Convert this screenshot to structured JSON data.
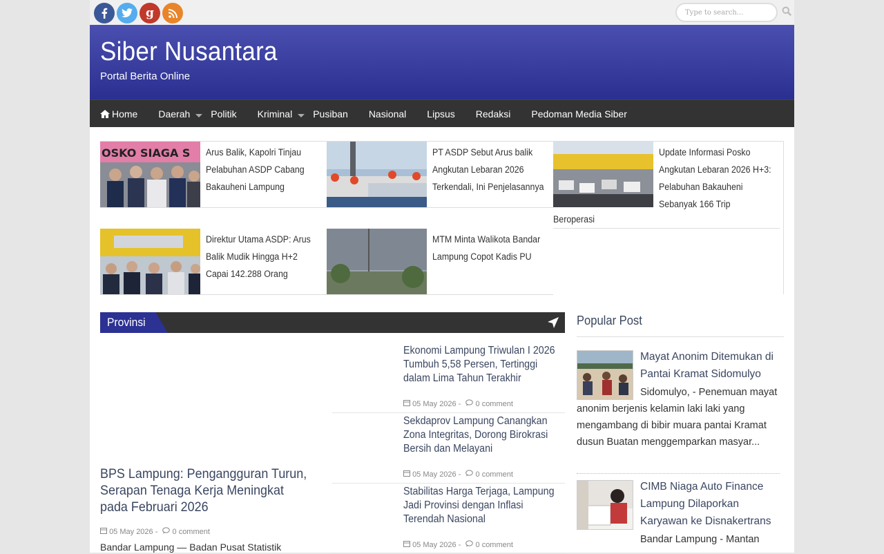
{
  "search": {
    "placeholder": "Type to search..."
  },
  "social": [
    {
      "name": "facebook",
      "color": "#3b5998",
      "glyph": "f"
    },
    {
      "name": "twitter",
      "color": "#55acee",
      "glyph": "t"
    },
    {
      "name": "google-plus",
      "color": "#c0392b",
      "glyph": "g"
    },
    {
      "name": "rss",
      "color": "#e8852b",
      "glyph": "rss"
    }
  ],
  "header": {
    "title": "Siber Nusantara",
    "description": "Portal Berita Online"
  },
  "nav": {
    "items": [
      {
        "label": "Home",
        "icon": "home-icon"
      },
      {
        "label": "Daerah",
        "has_sub": true
      },
      {
        "label": "Politik"
      },
      {
        "label": "Kriminal",
        "has_sub": true
      },
      {
        "label": "Pusiban"
      },
      {
        "label": "Nasional"
      },
      {
        "label": "Lipsus"
      },
      {
        "label": "Redaksi"
      },
      {
        "label": "Pedoman Media Siber"
      }
    ]
  },
  "featured": [
    "Arus Balik, Kapolri Tinjau Pelabuhan ASDP Cabang Bakauheni Lampung",
    "PT ASDP Sebut Arus balik Angkutan Lebaran 2026 Terkendali, Ini Penjelasannya",
    "Update Informasi Posko Angkutan Lebaran 2026 H+3: Pelabuhan Bakauheni Sebanyak 166 Trip",
    "Direktur Utama ASDP: Arus Balik Mudik Hingga H+2 Capai 142.288 Orang",
    "MTM Minta Walikota Bandar Lampung Copot Kadis PU"
  ],
  "featured_overflow": "Beroperasi",
  "section": {
    "label": "Provinsi",
    "icon": "location-arrow-icon"
  },
  "lead": {
    "title": "BPS Lampung: Pengangguran Turun, Serapan Tenaga Kerja Meningkat pada Februari 2026",
    "date": "05 May 2026 -",
    "comments": "0 comment",
    "excerpt": "Bandar Lampung — Badan Pusat Statistik"
  },
  "side_posts": [
    {
      "title": "Ekonomi Lampung Triwulan I 2026 Tumbuh 5,58 Persen, Tertinggi dalam Lima Tahun Terakhir",
      "date": "05 May 2026 -",
      "comments": "0 comment"
    },
    {
      "title": "Sekdaprov Lampung Canangkan Zona Integritas, Dorong Birokrasi Bersih dan Melayani",
      "date": "05 May 2026 -",
      "comments": "0 comment"
    },
    {
      "title": "Stabilitas Harga Terjaga, Lampung Jadi Provinsi dengan Inflasi Terendah Nasional",
      "date": "05 May 2026 -",
      "comments": "0 comment"
    }
  ],
  "popular": {
    "heading": "Popular Post",
    "items": [
      {
        "title": "Mayat Anonim Ditemukan di Pantai Kramat Sidomulyo",
        "excerpt": "Sidomulyo, - Penemuan mayat anonim berjenis kelamin laki laki yang mengambang di bibir muara pantai Kramat dusun Buatan menggemparkan masyar..."
      },
      {
        "title": "CIMB Niaga Auto Finance Lampung Dilaporkan Karyawan ke Disnakertrans",
        "excerpt": "Bandar Lampung - Mantan"
      }
    ]
  }
}
